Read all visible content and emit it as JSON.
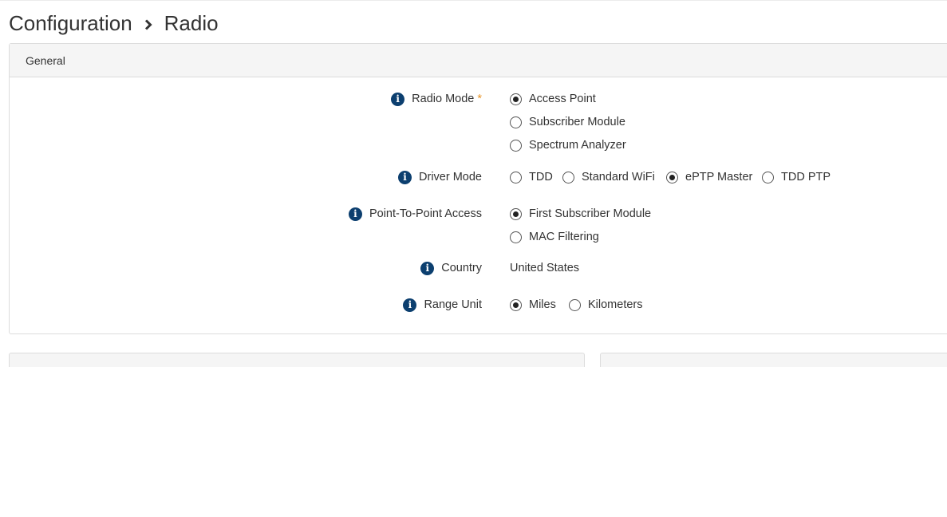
{
  "breadcrumb": {
    "parent": "Configuration",
    "current": "Radio"
  },
  "general": {
    "title": "General",
    "radio_mode": {
      "label": "Radio Mode",
      "required_mark": "*",
      "options": [
        "Access Point",
        "Subscriber Module",
        "Spectrum Analyzer"
      ],
      "selected": "Access Point"
    },
    "driver_mode": {
      "label": "Driver Mode",
      "options": [
        "TDD",
        "Standard WiFi",
        "ePTP Master",
        "TDD PTP"
      ],
      "selected": "ePTP Master"
    },
    "ptp_access": {
      "label": "Point-To-Point Access",
      "options": [
        "First Subscriber Module",
        "MAC Filtering"
      ],
      "selected": "First Subscriber Module"
    },
    "country": {
      "label": "Country",
      "value": "United States"
    },
    "range_unit": {
      "label": "Range Unit",
      "options": [
        "Miles",
        "Kilometers"
      ],
      "selected": "Miles"
    }
  },
  "colors": {
    "info_icon": "#0c3f6f",
    "required": "#e8962b",
    "header_bg": "#f5f5f5"
  }
}
